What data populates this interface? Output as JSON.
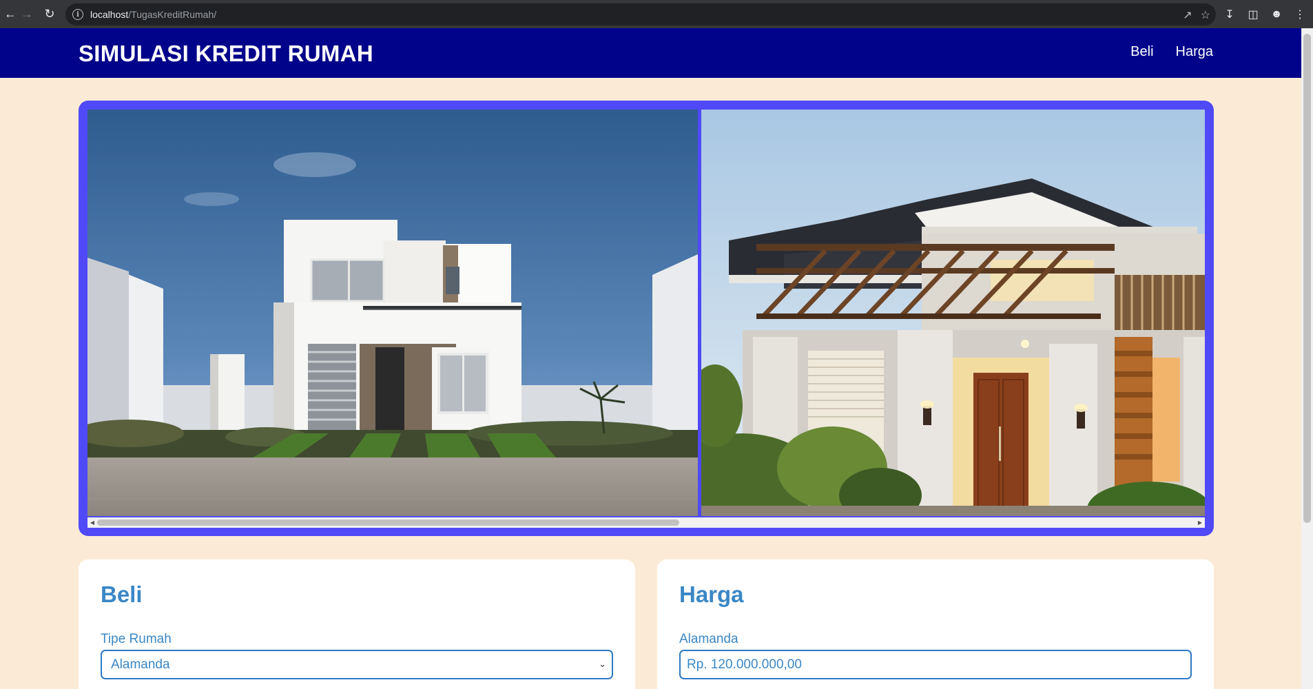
{
  "browser": {
    "url_host": "localhost",
    "url_path": "/TugasKreditRumah/"
  },
  "header": {
    "brand": "SIMULASI KREDIT RUMAH",
    "nav": [
      {
        "label": "Beli"
      },
      {
        "label": "Harga"
      }
    ]
  },
  "gallery": {
    "photos": [
      "modern-white-two-story-house",
      "tropical-house-with-pergola"
    ],
    "scroll_position": 0.0
  },
  "beli": {
    "title": "Beli",
    "tipe_label": "Tipe Rumah",
    "tipe_value": "Alamanda"
  },
  "harga": {
    "title": "Harga",
    "field_label": "Alamanda",
    "field_value": "Rp. 120.000.000,00"
  },
  "colors": {
    "header_bg": "#01038a",
    "page_bg": "#fbebd6",
    "gallery_frame": "#5049f7",
    "accent": "#3a87c6"
  }
}
